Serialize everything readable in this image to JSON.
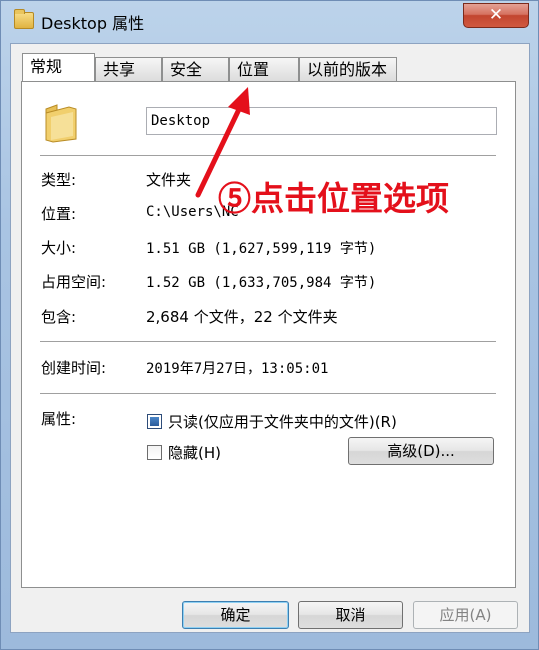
{
  "window": {
    "title": "Desktop 属性",
    "close_glyph": "✕"
  },
  "tabs": [
    {
      "label": "常规",
      "active": true
    },
    {
      "label": "共享"
    },
    {
      "label": "安全"
    },
    {
      "label": "位置"
    },
    {
      "label": "以前的版本"
    }
  ],
  "general": {
    "folder_icon": "folder-icon",
    "name_value": "Desktop",
    "rows": [
      {
        "label": "类型:",
        "value": "文件夹"
      },
      {
        "label": "位置:",
        "value": "C:\\Users\\NC"
      },
      {
        "label": "大小:",
        "value": "1.51 GB (1,627,599,119 字节)"
      },
      {
        "label": "占用空间:",
        "value": "1.52 GB (1,633,705,984 字节)"
      },
      {
        "label": "包含:",
        "value": "2,684 个文件，22 个文件夹"
      }
    ],
    "created_label": "创建时间:",
    "created_value": "2019年7月27日，13:05:01",
    "attributes_label": "属性:",
    "readonly_label": "只读(仅应用于文件夹中的文件)(R)",
    "readonly_checked": "partial",
    "hidden_label": "隐藏(H)",
    "hidden_checked": false,
    "advanced_button": "高级(D)..."
  },
  "footer": {
    "ok": "确定",
    "cancel": "取消",
    "apply": "应用(A)"
  },
  "annotation": {
    "text": "⑤点击位置选项",
    "color": "#e4101b"
  }
}
